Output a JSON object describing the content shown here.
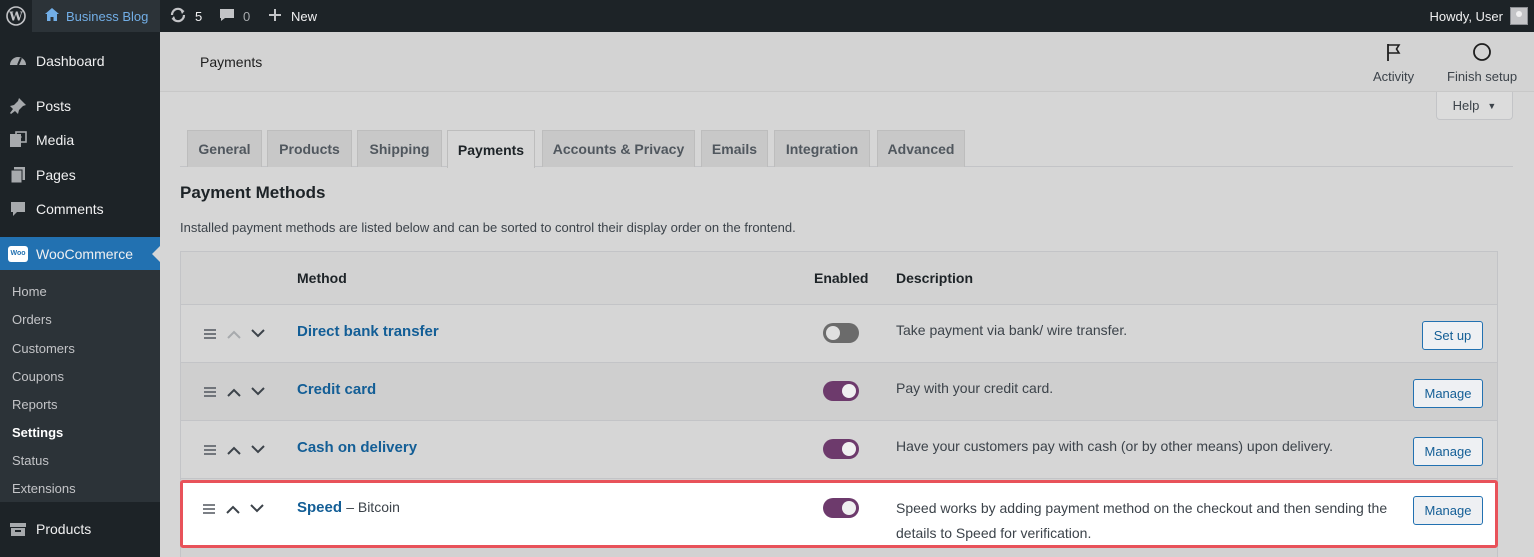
{
  "admin_bar": {
    "site_name": "Business Blog",
    "updates_count": "5",
    "comments_count": "0",
    "new_label": "New",
    "howdy": "Howdy, User"
  },
  "sidebar": {
    "items": [
      {
        "label": "Dashboard",
        "icon": "dashboard-icon"
      },
      {
        "label": "Posts",
        "icon": "pin-icon"
      },
      {
        "label": "Media",
        "icon": "media-icon"
      },
      {
        "label": "Pages",
        "icon": "pages-icon"
      },
      {
        "label": "Comments",
        "icon": "comment-icon"
      },
      {
        "label": "WooCommerce",
        "icon": "woo-icon"
      },
      {
        "label": "Products",
        "icon": "archive-icon"
      }
    ],
    "woo_logo_text": "Woo",
    "submenu": [
      "Home",
      "Orders",
      "Customers",
      "Coupons",
      "Reports",
      "Settings",
      "Status",
      "Extensions"
    ]
  },
  "header": {
    "title": "Payments",
    "activity_label": "Activity",
    "finish_setup_label": "Finish setup"
  },
  "help_label": "Help",
  "tabs": [
    "General",
    "Products",
    "Shipping",
    "Payments",
    "Accounts & Privacy",
    "Emails",
    "Integration",
    "Advanced"
  ],
  "section": {
    "title": "Payment Methods",
    "description": "Installed payment methods are listed below and can be sorted to control their display order on the frontend."
  },
  "table": {
    "headers": {
      "method": "Method",
      "enabled": "Enabled",
      "description": "Description"
    },
    "rows": [
      {
        "name": "Direct bank transfer",
        "suffix": "",
        "enabled": false,
        "description": "Take payment via bank/ wire transfer.",
        "action": "Set up"
      },
      {
        "name": "Credit card",
        "suffix": "",
        "enabled": true,
        "description": "Pay with your credit card.",
        "action": "Manage"
      },
      {
        "name": "Cash on delivery",
        "suffix": "",
        "enabled": true,
        "description": "Have your customers pay with cash (or by other means) upon delivery.",
        "action": "Manage"
      },
      {
        "name": "Speed",
        "suffix": "– Bitcoin",
        "enabled": true,
        "description": "Speed works by adding payment method on the checkout and then sending the details to Speed for verification.",
        "action": "Manage"
      }
    ]
  },
  "colors": {
    "accent": "#2271b1",
    "toggle_on": "#6d3a6c",
    "highlight": "#e8525a"
  }
}
